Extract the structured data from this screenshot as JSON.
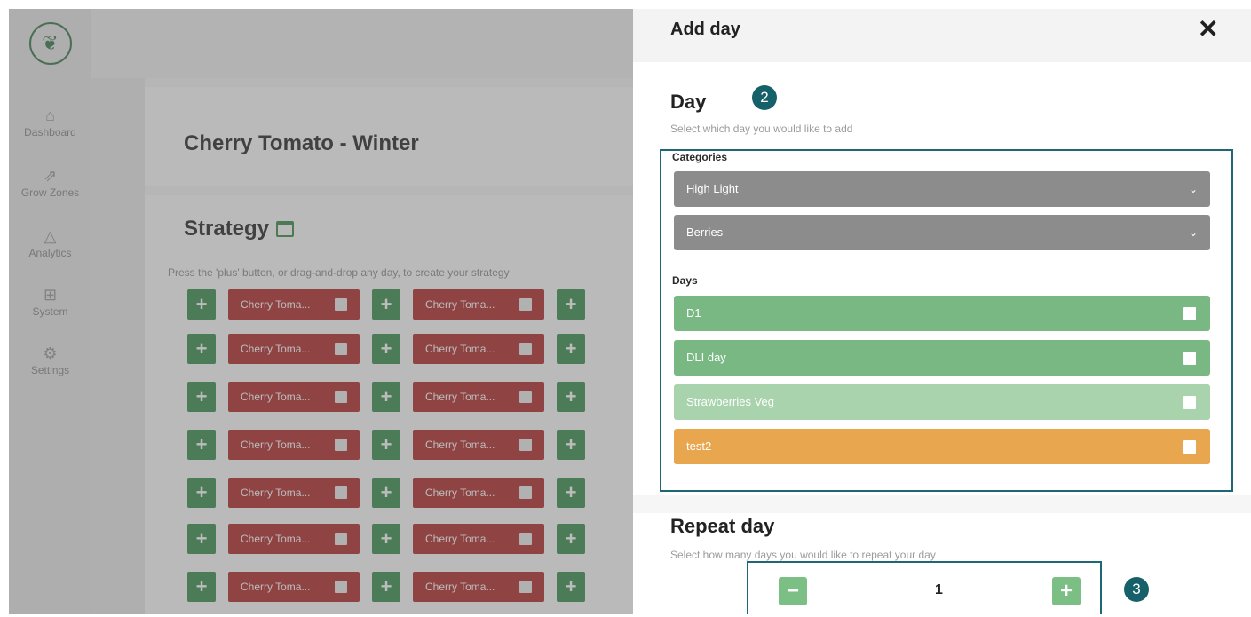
{
  "sidebar": {
    "items": [
      {
        "label": "Dashboard",
        "icon": "home-icon"
      },
      {
        "label": "Grow Zones",
        "icon": "grow-zones-icon"
      },
      {
        "label": "Analytics",
        "icon": "analytics-icon"
      },
      {
        "label": "System",
        "icon": "system-icon"
      },
      {
        "label": "Settings",
        "icon": "settings-icon"
      }
    ]
  },
  "page": {
    "title": "Cherry Tomato - Winter",
    "strategy_title": "Strategy",
    "strategy_hint": "Press the 'plus' button, or drag-and-drop any day, to create your strategy",
    "strategy_chip_label": "Cherry Toma...",
    "plus_symbol": "+"
  },
  "modal": {
    "title": "Add day",
    "close_symbol": "✕",
    "day_section": {
      "title": "Day",
      "subtitle": "Select which day you would like to add",
      "marker": "2",
      "categories_label": "Categories",
      "category_selects": [
        "High Light",
        "Berries"
      ],
      "days_label": "Days",
      "days": [
        {
          "label": "D1",
          "color": "#7ab883"
        },
        {
          "label": "DLI day",
          "color": "#7ab883"
        },
        {
          "label": "Strawberries Veg",
          "color": "#a9d3ad"
        },
        {
          "label": "test2",
          "color": "#e8a64f"
        }
      ]
    },
    "repeat_section": {
      "title": "Repeat day",
      "subtitle": "Select how many days you would like to repeat your day",
      "marker": "3",
      "value": "1",
      "minus_symbol": "−",
      "plus_symbol": "+"
    }
  },
  "colors": {
    "accent_green": "#3f8f52",
    "chip_red": "#b22f2f",
    "marker_teal": "#16606a"
  }
}
